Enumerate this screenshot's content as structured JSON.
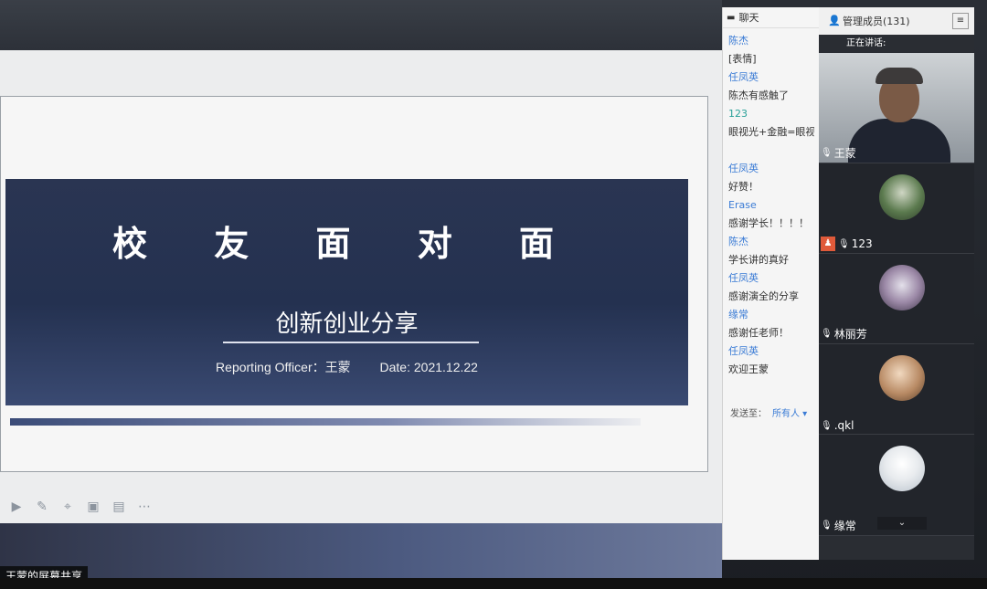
{
  "share": {
    "label": "王蒙的屏幕共享"
  },
  "slide": {
    "title": "校 友 面 对 面",
    "subtitle": "创新创业分享",
    "reporter": "Reporting Officer：王蒙",
    "date": "Date: 2021.12.22"
  },
  "toolbar": {
    "icons": [
      "play-icon",
      "pen-icon",
      "screenshot-icon",
      "camera-icon",
      "chat-icon",
      "more-icon"
    ]
  },
  "chat": {
    "title": "聊天",
    "messages": [
      {
        "name": "陈杰",
        "text": "[表情]"
      },
      {
        "name": "任凤英",
        "text": "陈杰有感触了"
      },
      {
        "name": "",
        "text": "123"
      },
      {
        "name": "",
        "text": "眼视光+金融=眼视光"
      },
      {
        "name": "任凤英",
        "text": "好赞！"
      },
      {
        "name": "Erase",
        "text": "感谢学长！！！！"
      },
      {
        "name": "陈杰",
        "text": "学长讲的真好"
      },
      {
        "name": "任凤英",
        "text": "感谢演全的分享"
      },
      {
        "name": "缘常",
        "text": "感谢任老师！"
      },
      {
        "name": "任凤英",
        "text": "欢迎王蒙"
      }
    ],
    "send_label": "发送至：",
    "send_target": "所有人 ▾"
  },
  "members": {
    "title": "管理成员(131)",
    "speaking_label": "正在讲话:",
    "list": [
      {
        "name": "王蒙"
      },
      {
        "name": "123"
      },
      {
        "name": "林丽芳"
      },
      {
        "name": ".qkl"
      },
      {
        "name": "缘常"
      }
    ]
  },
  "colors": {
    "banner": "#243150",
    "chat_name": "#3a7bd5",
    "panel_dark": "#2a2d33"
  }
}
